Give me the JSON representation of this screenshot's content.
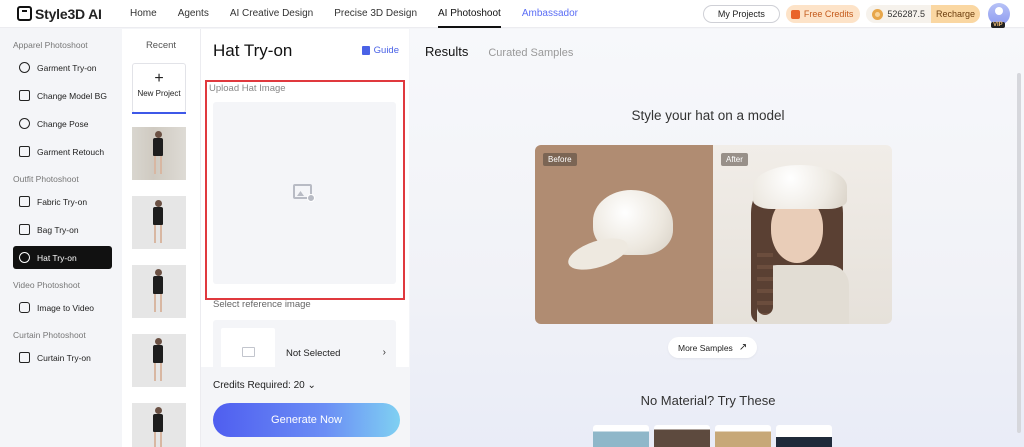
{
  "header": {
    "logo_text": "Style3D AI",
    "nav": [
      {
        "label": "Home"
      },
      {
        "label": "Agents"
      },
      {
        "label": "AI Creative Design"
      },
      {
        "label": "Precise 3D Design"
      },
      {
        "label": "AI Photoshoot"
      },
      {
        "label": "Ambassador"
      }
    ],
    "my_projects": "My Projects",
    "free_credits": "Free Credits",
    "credits_balance": "526287.5",
    "recharge": "Recharge",
    "vip_badge": "VIP"
  },
  "sidebar": {
    "sections": [
      {
        "title": "Apparel Photoshoot",
        "items": [
          {
            "label": "Garment Try-on",
            "icon": "shirt-icon"
          },
          {
            "label": "Change Model BG",
            "icon": "background-icon"
          },
          {
            "label": "Change Pose",
            "icon": "pose-icon"
          },
          {
            "label": "Garment Retouch",
            "icon": "retouch-icon"
          }
        ]
      },
      {
        "title": "Outfit Photoshoot",
        "items": [
          {
            "label": "Fabric Try-on",
            "icon": "fabric-icon"
          },
          {
            "label": "Bag Try-on",
            "icon": "bag-icon"
          },
          {
            "label": "Hat Try-on",
            "icon": "hat-icon",
            "active": true
          }
        ]
      },
      {
        "title": "Video Photoshoot",
        "items": [
          {
            "label": "Image to Video",
            "icon": "video-icon"
          }
        ]
      },
      {
        "title": "Curtain Photoshoot",
        "items": [
          {
            "label": "Curtain Try-on",
            "icon": "curtain-icon"
          }
        ]
      }
    ]
  },
  "recent": {
    "title": "Recent",
    "new_project_label": "New Project",
    "plus": "+"
  },
  "config": {
    "title": "Hat Try-on",
    "guide_label": "Guide",
    "upload_label": "Upload Hat Image",
    "reference_label": "Select reference image",
    "not_selected": "Not Selected",
    "chevron": "›",
    "credits_required": "Credits Required: 20 ⌄",
    "generate_label": "Generate Now"
  },
  "results": {
    "tabs": [
      "Results",
      "Curated Samples"
    ],
    "headline": "Style your hat on a model",
    "before_tag": "Before",
    "after_tag": "After",
    "more_samples": "More Samples",
    "arrow": "↗",
    "no_material": "No Material? Try These"
  },
  "colors": {
    "accent": "#4a62e6",
    "alert_frame": "#e0393e",
    "active_bg": "#111111"
  }
}
